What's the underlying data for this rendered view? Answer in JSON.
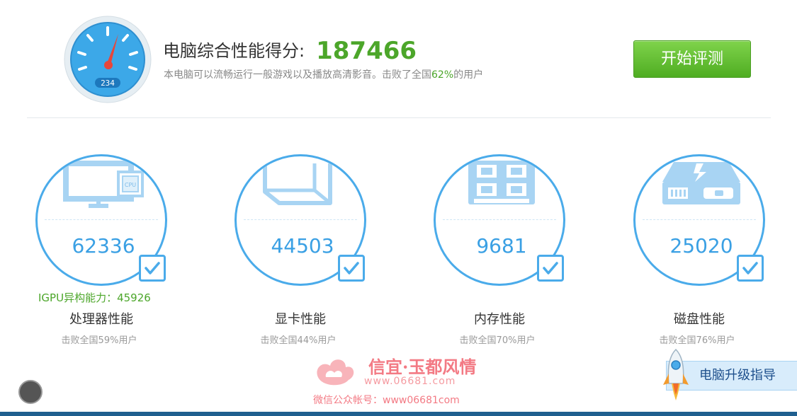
{
  "header": {
    "title": "电脑综合性能得分:",
    "score": "187466",
    "desc_prefix": "本电脑可以流畅运行一般游戏以及播放高清影音。击败了全国",
    "desc_percent": "62%",
    "desc_suffix": "的用户",
    "gauge_readout": "234",
    "start_button": "开始评测"
  },
  "metrics": [
    {
      "score": "62336",
      "label": "处理器性能",
      "sub": "击败全国59%用户",
      "chip_label": "CPU"
    },
    {
      "score": "44503",
      "label": "显卡性能",
      "sub": "击败全国44%用户"
    },
    {
      "score": "9681",
      "label": "内存性能",
      "sub": "击败全国70%用户"
    },
    {
      "score": "25020",
      "label": "磁盘性能",
      "sub": "击败全国76%用户"
    }
  ],
  "igpu": "IGPU异构能力：45926",
  "upgrade_button": "电脑升级指导",
  "watermark": {
    "name": "信宜·玉都风情",
    "url": "www.06681.com",
    "wechat": "微信公众帐号：www06681com"
  },
  "colors": {
    "accent_blue": "#4aabea",
    "score_green": "#4ca62a",
    "button_green": "#5cb82a"
  }
}
